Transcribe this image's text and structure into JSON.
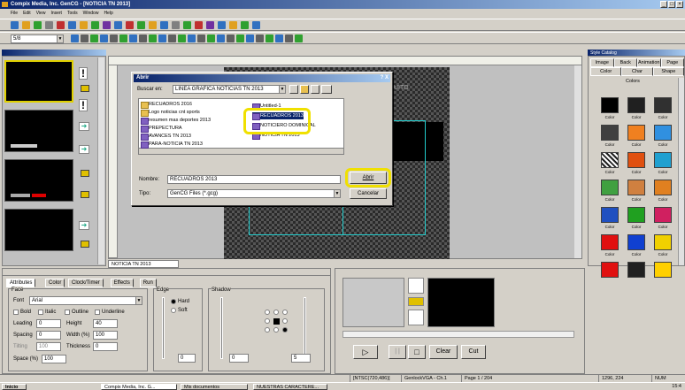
{
  "app": {
    "title": "Compix Media, Inc. GenCG - [NOTICIA TN 2013]"
  },
  "menu": [
    "File",
    "Edit",
    "View",
    "Insert",
    "Tools",
    "Window",
    "Help"
  ],
  "toolbar": {
    "font_size": "5/8"
  },
  "canvas": {
    "overlay_text": "UITO"
  },
  "doc_tab": "NOTICIA TN 2013",
  "dialog": {
    "title": "Abrir",
    "help_close": "? X",
    "look_in_label": "Buscar en:",
    "look_in_value": "LINEA GRAFICA NOTICIAS TN 2013",
    "files_col1": [
      {
        "name": "RECUADROS 2016",
        "type": "folder"
      },
      {
        "name": "Logo noticias cnt sports",
        "type": "folder"
      },
      {
        "name": "resumen mas deportes 2013",
        "type": "doc"
      },
      {
        "name": "PREPECTURA",
        "type": "doc"
      },
      {
        "name": "AVANCES TN 2013",
        "type": "doc"
      },
      {
        "name": "PARA-NOTICIA TN 2013",
        "type": "doc"
      }
    ],
    "files_col2": [
      {
        "name": "Untitled-1",
        "type": "doc"
      },
      {
        "name": "RECUADROS 2013",
        "type": "doc",
        "selected": true
      },
      {
        "name": "NOTICIERO DOMINICAL",
        "type": "doc"
      },
      {
        "name": "NOTICIA TN 2013",
        "type": "doc"
      }
    ],
    "name_label": "Nombre:",
    "name_value": "RECUADROS 2013",
    "type_label": "Tipo:",
    "type_value": "GenCG Files (*.gcg)",
    "open_button": "Abrir",
    "cancel_button": "Cancelar"
  },
  "right_panel": {
    "title": "Style Catalog",
    "tabs_row1": [
      "Image",
      "Back",
      "Animation",
      "Page"
    ],
    "tabs_row2": [
      "Color",
      "Char",
      "Shape"
    ],
    "section": "Colors",
    "swatch_label": "Color",
    "colors": [
      "#000000",
      "#202020",
      "#303030",
      "#404040",
      "#f08020",
      "#3090e0",
      "#505050",
      "#e05010",
      "#20a0d0",
      "#40a040",
      "#d08040",
      "#e08020",
      "#2050c0",
      "#20a020",
      "#d02060",
      "#e01010",
      "#1040d0",
      "#f0d000",
      "#e01010",
      "#202020",
      "#ffd000"
    ]
  },
  "attributes": {
    "tabs": [
      "Attributes",
      "Color",
      "Clock/Timer",
      "Effects",
      "Run"
    ],
    "face_label": "Face",
    "font_label": "Font",
    "font_value": "Arial",
    "bold": "Bold",
    "italic": "Italic",
    "outline": "Outline",
    "underline": "Underline",
    "leading_label": "Leading",
    "leading_value": "0",
    "height_label": "Height",
    "height_value": "40",
    "spacing_label": "Spacing",
    "spacing_value": "0",
    "width_label": "Width (%)",
    "width_value": "100",
    "tilting_label": "Tilting",
    "tilting_value": "100",
    "thickness_label": "Thickness",
    "thickness_value": "0",
    "space_label": "Space (%)",
    "space_value": "100",
    "edge_label": "Edge",
    "hard": "Hard",
    "soft": "Soft",
    "edge_value": "0",
    "shadow_label": "Shadow",
    "shadow_value": "0",
    "shadow_value2": "5"
  },
  "preview": {
    "play": "▷",
    "pause": "| |",
    "stop": "□",
    "clear": "Clear",
    "cut": "Cut"
  },
  "status": {
    "format": "[NTSC(720,486)]",
    "device": "GenlockVGA - Ch.1",
    "page": "Page 1 / 204",
    "coords": "1296, 224",
    "num": "NUM"
  },
  "taskbar": {
    "start": "Inicio",
    "tasks": [
      "Compix Media, Inc. G...",
      "Mis documentos",
      "NUESTRAS CARACTERE..."
    ],
    "clock": "15:4"
  }
}
